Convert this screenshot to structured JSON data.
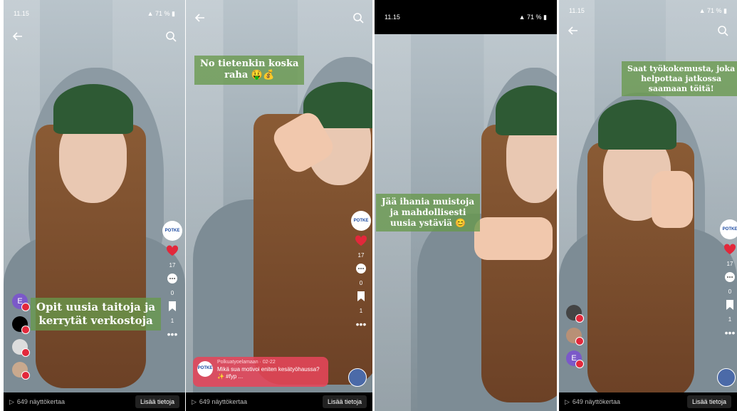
{
  "colors": {
    "accent": "#e2283b",
    "caption_bg": "#68994c"
  },
  "panels": [
    {
      "status_time": "11.15",
      "status_right": "71 %",
      "caption": [
        "Opit uusia taitoja ja",
        "kerrytät verkostoja"
      ],
      "likes": "17",
      "comments": "0",
      "saves": "1",
      "avatar_letter": "E",
      "views": "649 näyttökertaa",
      "more_button": "Lisää tietoja"
    },
    {
      "caption": [
        "No tietenkin koska",
        "raha 🤑💰"
      ],
      "likes": "17",
      "comments": "0",
      "saves": "1",
      "comment_author": "Polkuatyoelamaan · 02-22",
      "comment_text": "Mikä sua motivoi eniten kesätyöhaussa? ✨ #fyp ...",
      "views": "649 näyttökertaa",
      "more_button": "Lisää tietoja"
    },
    {
      "status_time": "11.15",
      "status_right": "71 %",
      "caption": [
        "Jää ihania muistoja",
        "ja mahdollisesti",
        "uusia ystäviä 😊"
      ]
    },
    {
      "status_time": "11.15",
      "status_right": "71 %",
      "caption": [
        "Saat työkokemusta, joka",
        "helpottaa jatkossa",
        "saamaan töitä!"
      ],
      "likes": "17",
      "comments": "0",
      "saves": "1",
      "avatar_letter": "E",
      "views": "649 näyttökertaa",
      "more_button": "Lisää tietoja"
    }
  ]
}
